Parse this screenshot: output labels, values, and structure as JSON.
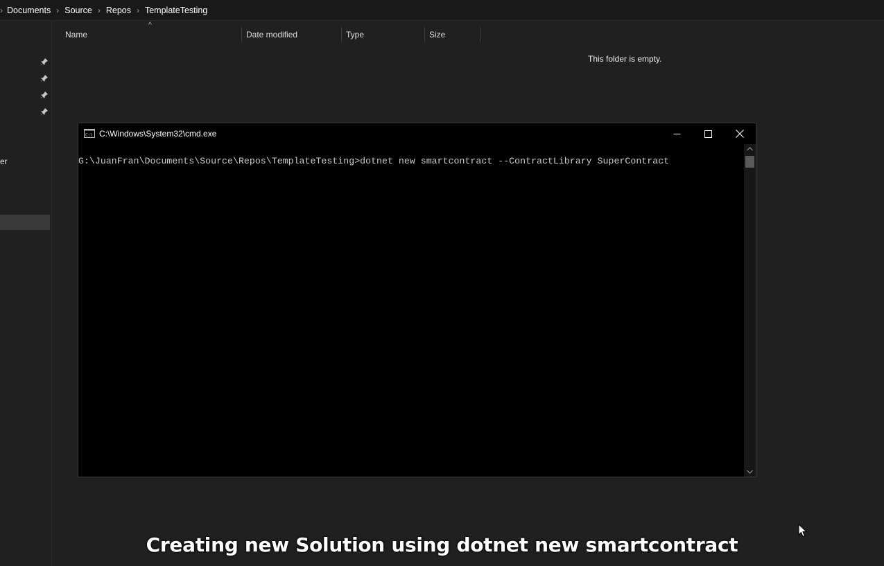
{
  "addressbar": {
    "breadcrumbs": [
      "Documents",
      "Source",
      "Repos",
      "TemplateTesting"
    ]
  },
  "navpane": {
    "partial_label": "er",
    "pin_icon": "pin-icon"
  },
  "filelist": {
    "columns": [
      "Name",
      "Date modified",
      "Type",
      "Size"
    ],
    "sort_indicator": "^",
    "empty_message": "This folder is empty."
  },
  "cmd": {
    "title": "C:\\Windows\\System32\\cmd.exe",
    "line": "G:\\JuanFran\\Documents\\Source\\Repos\\TemplateTesting>dotnet new smartcontract --ContractLibrary SuperContract"
  },
  "caption": "Creating new Solution using dotnet new smartcontract",
  "colors": {
    "explorer_bg": "#202020",
    "addressbar_bg": "#191919",
    "cmd_bg": "#000000",
    "cmd_text": "#cccccc"
  }
}
